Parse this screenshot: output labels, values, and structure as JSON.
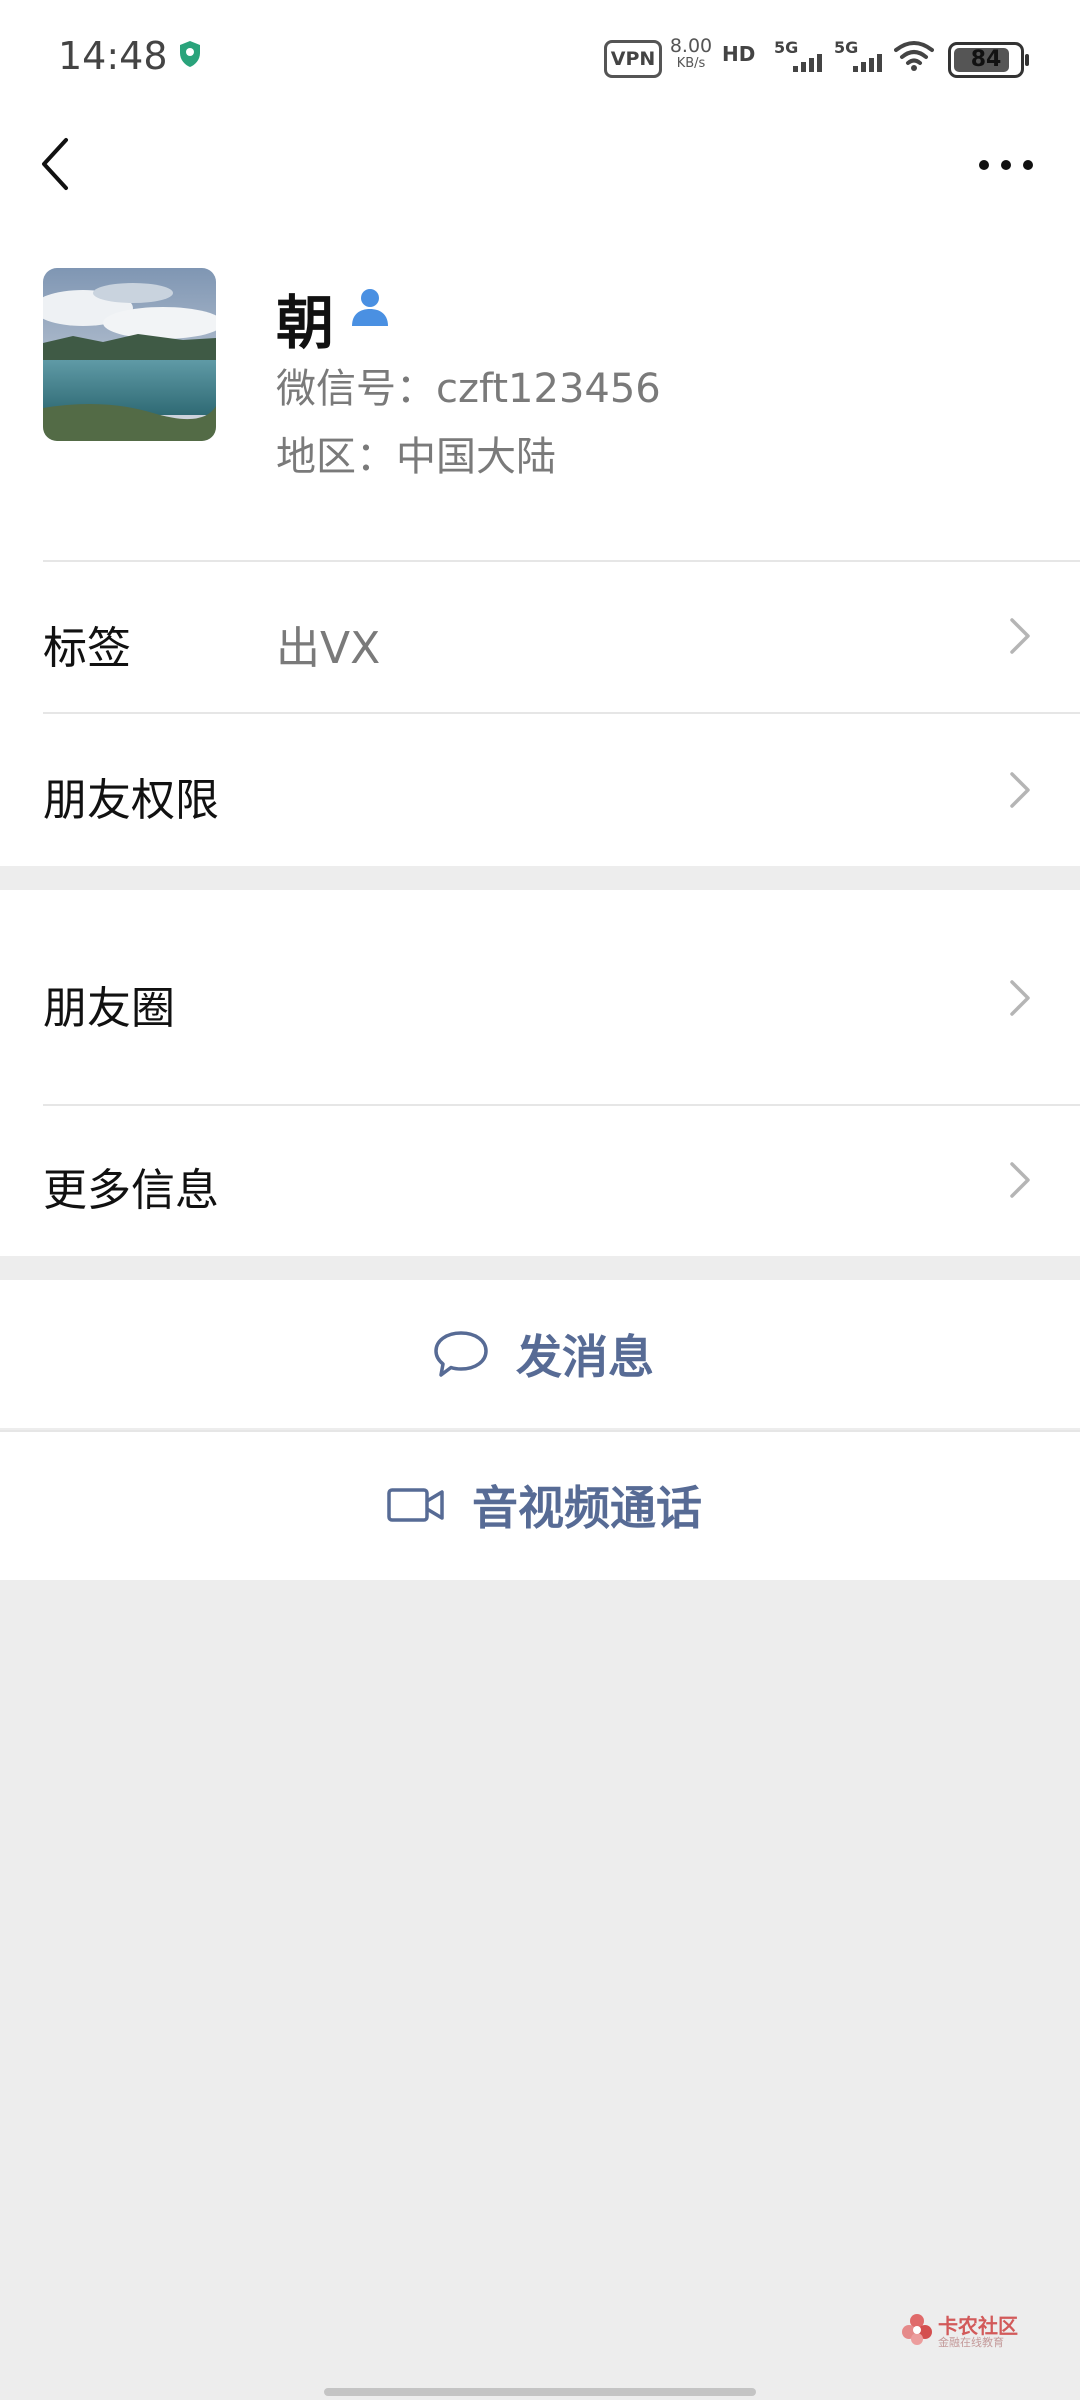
{
  "status_bar": {
    "time": "14:48",
    "vpn": "VPN",
    "speed_value": "8.00",
    "speed_unit": "KB/s",
    "hd": "HD",
    "sim1_network": "5G",
    "sim2_network": "5G",
    "battery": "84"
  },
  "profile": {
    "name": "朝",
    "wechat_id": "微信号：czft123456",
    "region": "地区：中国大陆"
  },
  "rows": {
    "tags_label": "标签",
    "tags_value": "出VX",
    "friend_permissions": "朋友权限",
    "moments": "朋友圈",
    "more_info": "更多信息"
  },
  "actions": {
    "send_message": "发消息",
    "video_call": "音视频通话"
  },
  "watermark": {
    "title": "卡农社区",
    "subtitle": "金融在线教育"
  },
  "colors": {
    "link_blue": "#576b95",
    "background": "#ededed",
    "secondary_text": "#7a7a7a"
  }
}
